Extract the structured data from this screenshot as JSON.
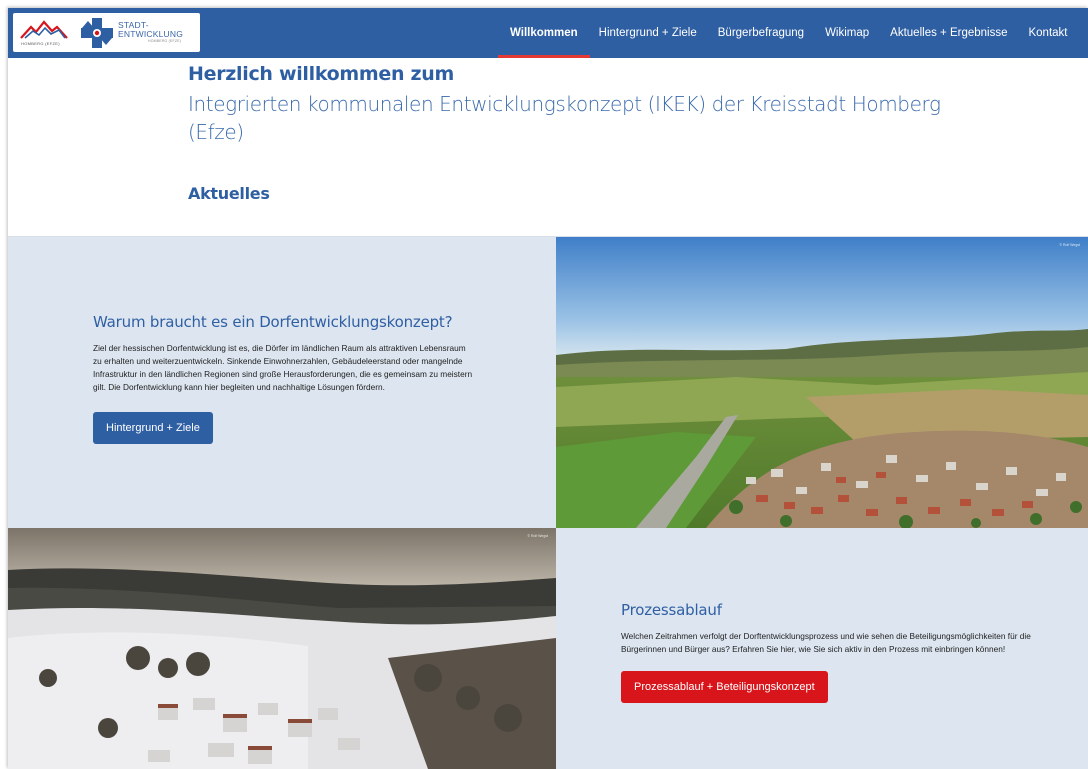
{
  "brand": {
    "logo_left_text": "HOMBERG (EFZE)",
    "logo_text_line1": "STADT-",
    "logo_text_line2": "ENTWICKLUNG",
    "logo_text_sub": "HOMBERG (EFZE)",
    "color_primary": "#2f5fa3",
    "color_accent": "#d7151b"
  },
  "nav": {
    "items": [
      {
        "label": "Willkommen",
        "active": true
      },
      {
        "label": "Hintergrund + Ziele"
      },
      {
        "label": "Bürgerbefragung"
      },
      {
        "label": "Wikimap"
      },
      {
        "label": "Aktuelles + Ergebnisse"
      },
      {
        "label": "Kontakt"
      }
    ]
  },
  "welcome": {
    "title": "Herzlich willkommen zum",
    "subtitle": "Integrierten kommunalen Entwicklungskonzept (IKEK) der Kreisstadt Homberg (Efze)"
  },
  "aktuelles": {
    "heading": "Aktuelles"
  },
  "section_dorf": {
    "title": "Warum braucht es ein Dorfentwicklungskonzept?",
    "text": "Ziel der hessischen Dorfentwicklung ist es, die Dörfer im ländlichen Raum als attraktiven Lebensraum zu erhalten und weiterzuentwickeln. Sinkende Einwohnerzahlen, Gebäudeleerstand oder mangelnde Infrastruktur in den ländlichen Regionen sind große Herausforderungen, die es gemeinsam zu meistern gilt. Die Dorfentwicklung kann hier begleiten und nachhaltige Lösungen fördern.",
    "button": "Hintergrund + Ziele",
    "photo_credit": "© Rolf Wegst"
  },
  "section_prozess": {
    "title": "Prozessablauf",
    "text": "Welchen Zeitrahmen verfolgt der Dorftentwicklungsprozess und wie sehen die Beteiligungsmöglichkeiten für die Bürgerinnen und Bürger aus? Erfahren Sie hier, wie Sie sich aktiv in den Prozess mit einbringen können!",
    "button": "Prozessablauf + Beteiligungskonzept",
    "photo_credit": "© Rolf Wegst"
  }
}
